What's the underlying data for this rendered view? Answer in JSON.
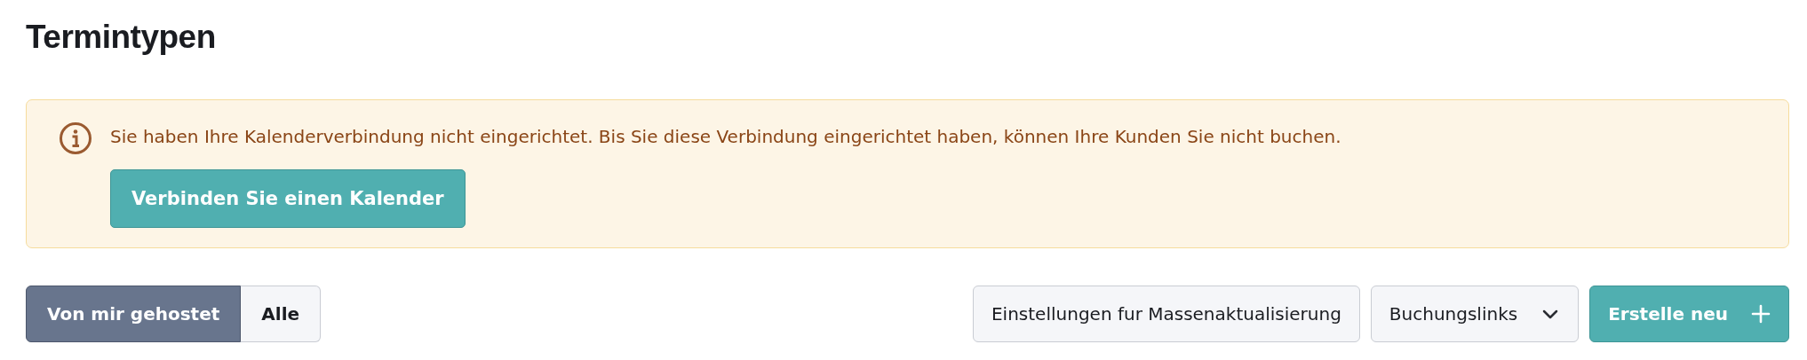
{
  "page_title": "Termintypen",
  "alert": {
    "message": "Sie haben Ihre Kalenderverbindung nicht eingerichtet. Bis Sie diese Verbindung eingerichtet haben, können Ihre Kunden Sie nicht buchen.",
    "button": "Verbinden Sie einen Kalender"
  },
  "filter_tabs": [
    {
      "label": "Von mir gehostet",
      "selected": true
    },
    {
      "label": "Alle",
      "selected": false
    }
  ],
  "actions": [
    {
      "kind": "plain",
      "label": "Einstellungen fur Massenaktualisierung"
    },
    {
      "kind": "dropdown",
      "label": "Buchungslinks"
    },
    {
      "kind": "create",
      "label": "Erstelle neu"
    }
  ]
}
